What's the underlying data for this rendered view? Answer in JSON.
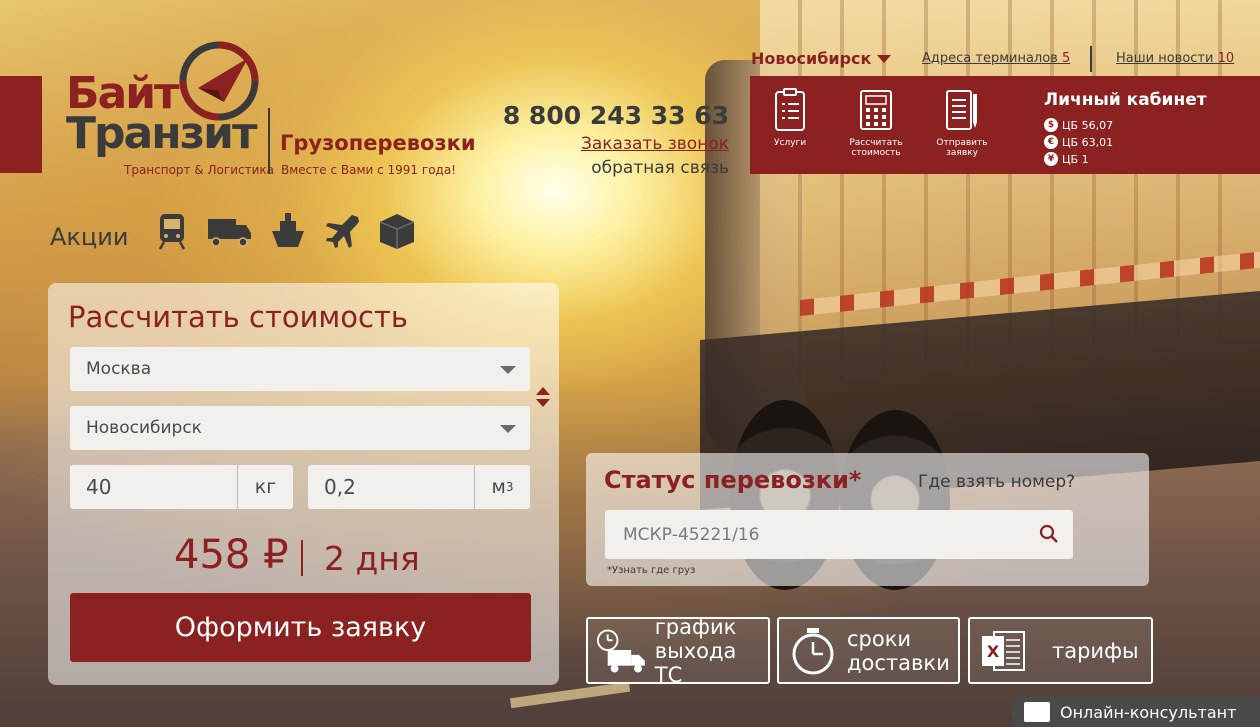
{
  "brand": {
    "name_line1": "Байт",
    "name_line2": "Транзит",
    "tagline": "Транспорт & Логистика",
    "title": "Грузоперевозки",
    "subtitle": "Вместе с Вами с 1991 года!"
  },
  "contacts": {
    "phone": "8 800 243 33 63",
    "callback_label": "Заказать звонок",
    "feedback_label": "обратная связь"
  },
  "top_nav": {
    "city": "Новосибирск",
    "terminals_label": "Адреса терминалов",
    "terminals_count": "5",
    "news_label": "Наши новости",
    "news_count": "10"
  },
  "cabinet": {
    "items": [
      {
        "label": "Услуги",
        "icon": "services-list-icon"
      },
      {
        "label": "Рассчитать стоимость",
        "icon": "calculator-icon"
      },
      {
        "label": "Отправить заявку",
        "icon": "document-pen-icon"
      }
    ],
    "title": "Личный кабинет",
    "rates": [
      {
        "symbol": "$",
        "text": "ЦБ 56,07"
      },
      {
        "symbol": "€",
        "text": "ЦБ 63,01"
      },
      {
        "symbol": "¥",
        "text": "ЦБ 1"
      }
    ]
  },
  "promo": {
    "label": "Акции",
    "icons": [
      "train-icon",
      "truck-icon",
      "ship-icon",
      "plane-icon",
      "box-icon"
    ]
  },
  "calculator": {
    "title": "Рассчитать стоимость",
    "from": "Москва",
    "to": "Новосибирск",
    "weight": "40",
    "weight_unit": "кг",
    "volume": "0,2",
    "volume_unit": "м",
    "volume_exp": "3",
    "price": "458 ₽",
    "days": "2 дня",
    "order_label": "Оформить заявку"
  },
  "status": {
    "title": "Статус перевозки*",
    "help_label": "Где взять номер?",
    "tracking_value": "МСКР-45221/16",
    "note": "*Узнать где груз"
  },
  "quick_links": [
    {
      "line1": "график",
      "line2": "выхода ТС",
      "icon": "schedule-truck-icon"
    },
    {
      "line1": "сроки",
      "line2": "доставки",
      "icon": "stopwatch-icon"
    },
    {
      "line1": "тарифы",
      "line2": "",
      "icon": "excel-icon"
    }
  ],
  "consultant": {
    "label": "Онлайн-консультант"
  },
  "colors": {
    "brand": "#8b2121",
    "dark": "#3b3b3b"
  }
}
